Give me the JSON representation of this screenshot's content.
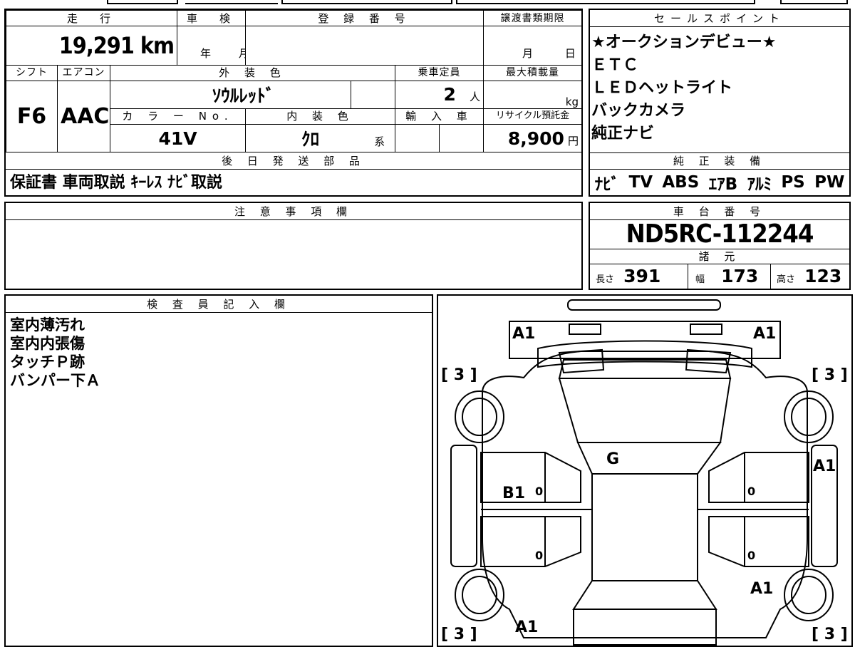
{
  "vehicle": {
    "mileage_label": "走　行",
    "mileage_value": "19,291",
    "mileage_unit": "km",
    "inspection_label": "車　検",
    "inspection_year": "年",
    "inspection_month": "月",
    "registration_label": "登 録 番 号",
    "registration_value": "",
    "transfer_label": "譲渡書類期限",
    "transfer_month": "月",
    "transfer_day": "日",
    "shift_label": "シフト",
    "shift_value": "F6",
    "ac_label": "エアコン",
    "ac_value": "AAC",
    "exterior_label": "外 装 色",
    "exterior_value": "ｿｳﾙﾚｯﾄﾞ",
    "capacity_label": "乗車定員",
    "capacity_value": "2",
    "capacity_unit": "人",
    "load_label": "最大積載量",
    "load_unit": "kg",
    "color_no_label": "カ ラ ー No.",
    "color_no_value": "41V",
    "interior_label": "内 装 色",
    "interior_value": "ｸﾛ",
    "interior_unit": "系",
    "import_label": "輸 入 車",
    "recycle_label": "リサイクル預託金",
    "recycle_value": "8,900",
    "recycle_unit": "円"
  },
  "later_parts": {
    "header": "後 日 発 送 部 品",
    "value": "保証書 車両取説 ｷｰﾚｽ ﾅﾋﾞ取説"
  },
  "sales_points": {
    "header": "セールスポイント",
    "items": [
      "★オークションデビュー★",
      "ＥＴＣ",
      "ＬＥＤヘットライト",
      "バックカメラ",
      "純正ナビ"
    ]
  },
  "equipment": {
    "header": "純 正 装 備",
    "items": [
      "ﾅﾋﾞ",
      "TV",
      "ABS",
      "ｴｱB",
      "ｱﾙﾐ",
      "PS",
      "PW"
    ]
  },
  "notes": {
    "header": "注 意 事 項 欄",
    "value": ""
  },
  "chassis": {
    "header": "車 台 番 号",
    "value": "ND5RC-112244"
  },
  "specs": {
    "header": "諸 元",
    "length_label": "長さ",
    "length_value": "391",
    "width_label": "幅",
    "width_value": "173",
    "height_label": "高さ",
    "height_value": "123"
  },
  "inspector": {
    "header": "検 査 員 記 入 欄",
    "lines": [
      "室内薄汚れ",
      "室内内張傷",
      "タッチＰ跡",
      "バンパー下Ａ"
    ]
  },
  "diagram": {
    "marks": {
      "front_left_bumper": "A1",
      "front_right_bumper": "A1",
      "front_left_tire": "[ 3 ]",
      "front_right_tire": "[ 3 ]",
      "windshield": "G",
      "left_front_door": "B1",
      "right_fender": "A1",
      "rear_right_quarter": "A1",
      "rear_left": "A1",
      "rear_left_tire": "[ 3 ]",
      "rear_right_tire": "[ 3 ]",
      "door_zero": "0"
    }
  }
}
